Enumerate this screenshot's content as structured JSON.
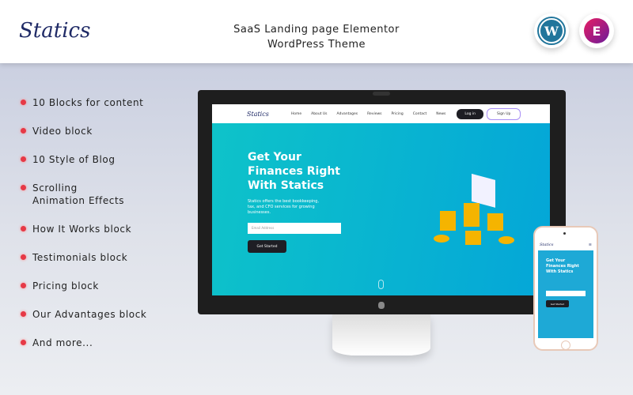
{
  "header": {
    "logo": "Statics",
    "title_line1": "SaaS Landing page Elementor",
    "title_line2": "WordPress Theme",
    "badges": [
      {
        "icon": "wordpress-icon",
        "color": "#21759b"
      },
      {
        "icon": "elementor-icon",
        "color": "#c2185b"
      }
    ]
  },
  "features": [
    "10 Blocks for content",
    "Video block",
    "10 Style of Blog",
    "Scrolling\nAnimation Effects",
    "How It Works block",
    "Testimonials block",
    "Pricing block",
    "Our Advantages block",
    "And more..."
  ],
  "desktop": {
    "logo": "Statics",
    "nav": [
      "Home",
      "About Us",
      "Advantages",
      "Reviews",
      "Pricing",
      "Contact",
      "News"
    ],
    "login": "Log in",
    "signup": "Sign Up",
    "headline": "Get Your Finances Right With Statics",
    "sub": "Statics offers the best bookkeeping, tax, and CFO services for growing businesses.",
    "email_placeholder": "Email Address",
    "cta": "Get Started"
  },
  "mobile": {
    "logo": "Statics",
    "headline": "Get Your Finances Right With Statics",
    "cta": "Get Started"
  }
}
